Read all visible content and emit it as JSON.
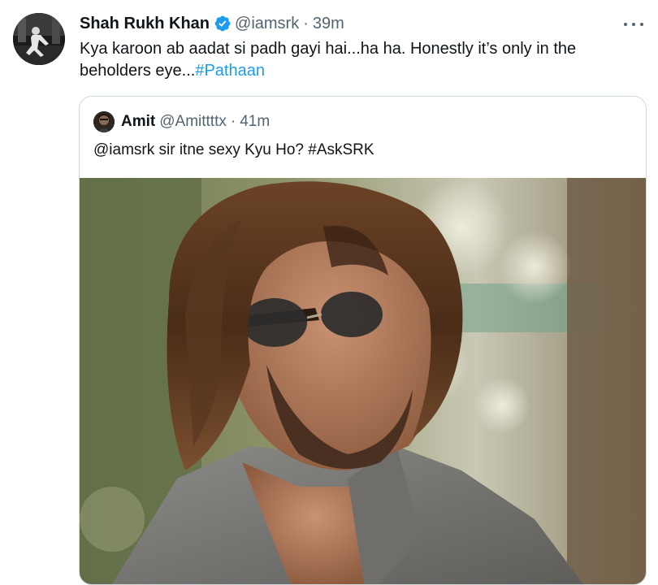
{
  "tweet": {
    "author_name": "Shah Rukh Khan",
    "author_handle": "@iamsrk",
    "separator": "·",
    "time": "39m",
    "text": "Kya karoon ab aadat si padh gayi hai...ha ha. Honestly it’s only in the beholders eye...",
    "hashtag": "#Pathaan",
    "verified_color": "#1d9bf0",
    "more_icon": "more-horizontal-icon"
  },
  "quote": {
    "author_name": "Amit",
    "author_handle": "@Amittttx",
    "separator": "·",
    "time": "41m",
    "text": "@iamsrk sir itne sexy Kyu Ho? #AskSRK"
  },
  "colors": {
    "text_primary": "#0f1419",
    "text_secondary": "#536471",
    "link": "#1d9bf0",
    "border": "#cfd9de"
  }
}
